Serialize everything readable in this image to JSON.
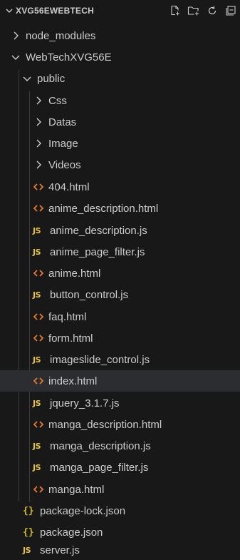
{
  "explorer": {
    "title": "XVG56EWEBTECH",
    "actions": [
      "new-file-icon",
      "new-folder-icon",
      "refresh-icon",
      "collapse-all-icon"
    ]
  },
  "tree": {
    "node_modules": "node_modules",
    "webtech": "WebTechXVG56E",
    "public": "public",
    "css": "Css",
    "datas": "Datas",
    "image": "Image",
    "videos": "Videos",
    "f404": "404.html",
    "anime_description_html": "anime_description.html",
    "anime_description_js": "anime_description.js",
    "anime_page_filter_js": "anime_page_filter.js",
    "anime_html": "anime.html",
    "button_control_js": "button_control.js",
    "faq_html": "faq.html",
    "form_html": "form.html",
    "imageslide_control_js": "imageslide_control.js",
    "index_html": "index.html",
    "jquery_js": "jquery_3.1.7.js",
    "manga_description_html": "manga_description.html",
    "manga_description_js": "manga_description.js",
    "manga_page_filter_js": "manga_page_filter.js",
    "manga_html": "manga.html",
    "package_lock_json": "package-lock.json",
    "package_json": "package.json",
    "server_js": "server.js"
  },
  "badges": {
    "js": "JS",
    "json": "{}"
  },
  "colors": {
    "background": "#181818",
    "text": "#cccccc",
    "selected_row": "#2b2d30",
    "html_icon": "#e37933",
    "js_icon": "#e8c23c",
    "json_icon": "#d4b832",
    "guide": "#3c3c3c"
  }
}
